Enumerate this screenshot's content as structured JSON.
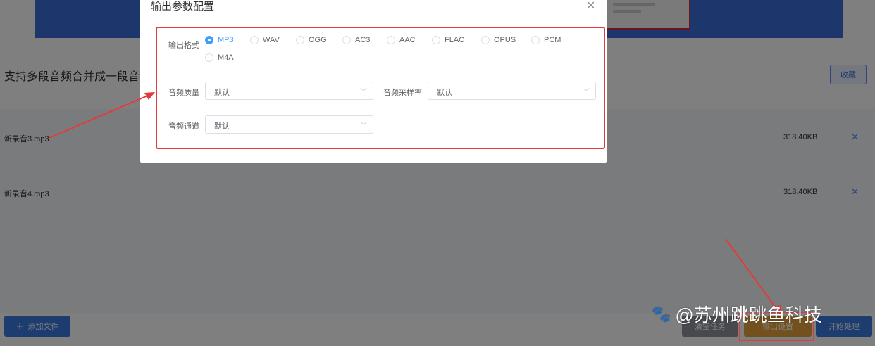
{
  "page": {
    "title": "支持多段音频合并成一段音频",
    "favorite_label": "收藏",
    "files": [
      {
        "name": "新录音3.mp3",
        "size": "318.40KB"
      },
      {
        "name": "新录音4.mp3",
        "size": "318.40KB"
      }
    ],
    "add_file_label": "添加文件",
    "clear_label": "清空任务",
    "output_settings_label": "输出设置",
    "start_label": "开始处理"
  },
  "dialog": {
    "title": "输出参数配置",
    "format_label": "输出格式",
    "formats": [
      "MP3",
      "WAV",
      "OGG",
      "AC3",
      "AAC",
      "FLAC",
      "OPUS",
      "PCM",
      "M4A"
    ],
    "selected_format": "MP3",
    "quality_label": "音频质量",
    "quality_value": "默认",
    "samplerate_label": "音频采样率",
    "samplerate_value": "默认",
    "channel_label": "音频通道",
    "channel_value": "默认"
  },
  "watermark": {
    "text": "@苏州跳跳鱼科技"
  },
  "colors": {
    "accent": "#409eff",
    "highlight_frame": "#e23b3b",
    "overlay": "rgba(0,0,0,0.5)"
  }
}
